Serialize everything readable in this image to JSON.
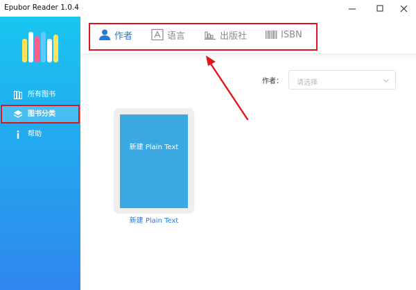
{
  "window": {
    "title": "Epubor Reader 1.0.4"
  },
  "sidebar": {
    "items": [
      {
        "label": "所有图书",
        "icon": "books-icon",
        "active": false
      },
      {
        "label": "图书分类",
        "icon": "layers-icon",
        "active": true
      },
      {
        "label": "帮助",
        "icon": "info-icon",
        "active": false
      }
    ]
  },
  "tabs": [
    {
      "label": "作者",
      "icon": "user-icon",
      "active": true
    },
    {
      "label": "语言",
      "icon": "language-icon",
      "active": false
    },
    {
      "label": "出版社",
      "icon": "publisher-icon",
      "active": false
    },
    {
      "label": "ISBN",
      "icon": "barcode-icon",
      "active": false
    }
  ],
  "filter": {
    "label": "作者：",
    "placeholder": "请选择"
  },
  "books": [
    {
      "cover_title": "新建 Plain Text",
      "caption": "新建 Plain Text"
    }
  ],
  "colors": {
    "sidebar_top": "#19c6f0",
    "sidebar_bottom": "#2f86ee",
    "accent": "#2a78d6",
    "annotation": "#e0151c",
    "cover": "#3aa8e2"
  }
}
